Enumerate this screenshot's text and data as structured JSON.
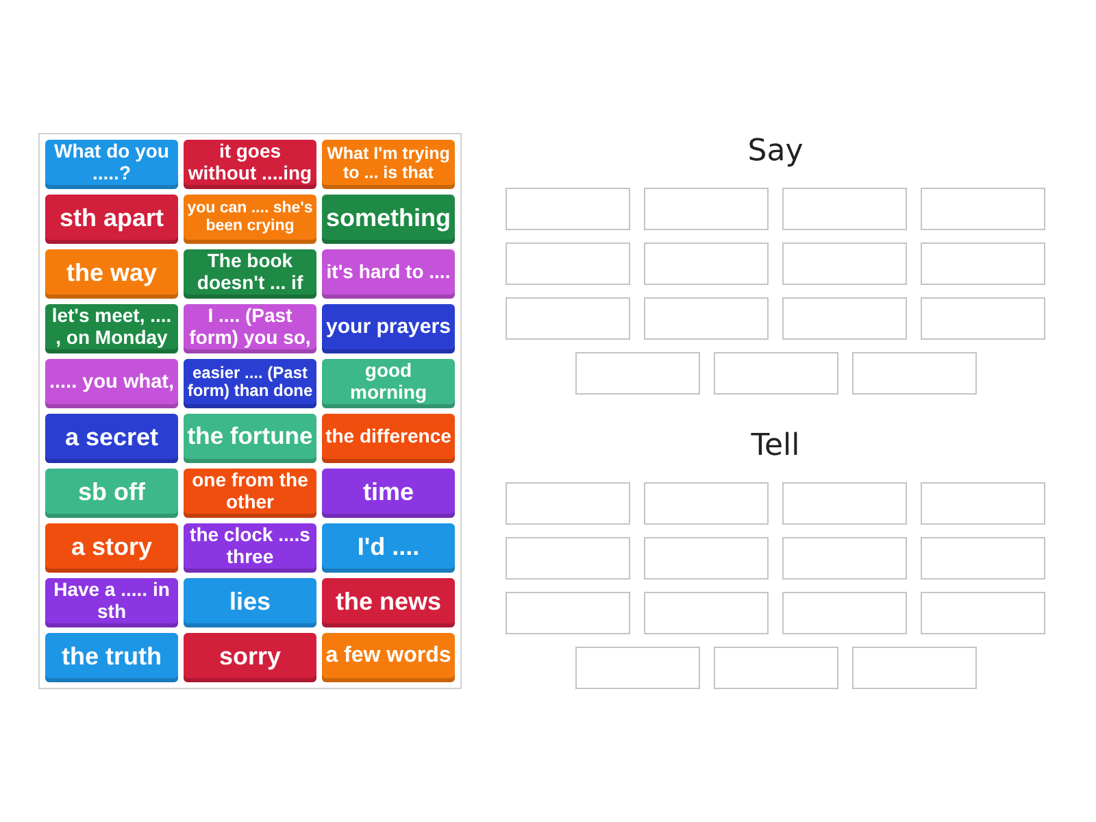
{
  "tiles": [
    {
      "text": "What do you .....?",
      "color": "#1e96e6"
    },
    {
      "text": "it goes without ....ing",
      "color": "#d21f3c"
    },
    {
      "text": "What I'm trying to ... is that",
      "color": "#f57c0c"
    },
    {
      "text": "sth apart",
      "color": "#d21f3c"
    },
    {
      "text": "you can .... she's been crying",
      "color": "#f57c0c"
    },
    {
      "text": "something",
      "color": "#1e8a46"
    },
    {
      "text": "the way",
      "color": "#f57c0c"
    },
    {
      "text": "The book doesn't ... if",
      "color": "#1e8a46"
    },
    {
      "text": "it's hard to ....",
      "color": "#c553d9"
    },
    {
      "text": "let's meet, .... , on Monday",
      "color": "#1e8a46"
    },
    {
      "text": "I .... (Past form) you so,",
      "color": "#c553d9"
    },
    {
      "text": "your prayers",
      "color": "#2a3fd2"
    },
    {
      "text": "..... you what,",
      "color": "#c553d9"
    },
    {
      "text": "easier .... (Past form) than done",
      "color": "#2a3fd2"
    },
    {
      "text": "good morning",
      "color": "#3db88a"
    },
    {
      "text": "a secret",
      "color": "#2a3fd2"
    },
    {
      "text": "the fortune",
      "color": "#3db88a"
    },
    {
      "text": "the difference",
      "color": "#f04e0e"
    },
    {
      "text": "sb off",
      "color": "#3db88a"
    },
    {
      "text": "one from the other",
      "color": "#f04e0e"
    },
    {
      "text": "time",
      "color": "#8b36e2"
    },
    {
      "text": "a story",
      "color": "#f04e0e"
    },
    {
      "text": "the clock ....s three",
      "color": "#8b36e2"
    },
    {
      "text": "I'd ....",
      "color": "#1e96e6"
    },
    {
      "text": "Have a ..... in sth",
      "color": "#8b36e2"
    },
    {
      "text": "lies",
      "color": "#1e96e6"
    },
    {
      "text": "the news",
      "color": "#d21f3c"
    },
    {
      "text": "the truth",
      "color": "#1e96e6"
    },
    {
      "text": "sorry",
      "color": "#d21f3c"
    },
    {
      "text": "a few words",
      "color": "#f57c0c"
    }
  ],
  "groups": [
    {
      "title": "Say",
      "slots": [
        {
          "kind": "empty"
        },
        {
          "kind": "empty"
        },
        {
          "kind": "empty"
        },
        {
          "kind": "empty"
        },
        {
          "kind": "empty"
        },
        {
          "kind": "empty"
        },
        {
          "kind": "empty"
        },
        {
          "kind": "empty"
        },
        {
          "kind": "empty"
        },
        {
          "kind": "empty"
        },
        {
          "kind": "empty"
        },
        {
          "kind": "empty"
        },
        {
          "kind": "empty"
        },
        {
          "kind": "empty"
        },
        {
          "kind": "empty"
        }
      ]
    },
    {
      "title": "Tell",
      "slots": [
        {
          "kind": "empty"
        },
        {
          "kind": "empty"
        },
        {
          "kind": "empty"
        },
        {
          "kind": "empty"
        },
        {
          "kind": "empty"
        },
        {
          "kind": "empty"
        },
        {
          "kind": "empty"
        },
        {
          "kind": "empty"
        },
        {
          "kind": "empty"
        },
        {
          "kind": "empty"
        },
        {
          "kind": "empty"
        },
        {
          "kind": "empty"
        },
        {
          "kind": "empty"
        },
        {
          "kind": "empty"
        },
        {
          "kind": "empty"
        }
      ]
    }
  ]
}
